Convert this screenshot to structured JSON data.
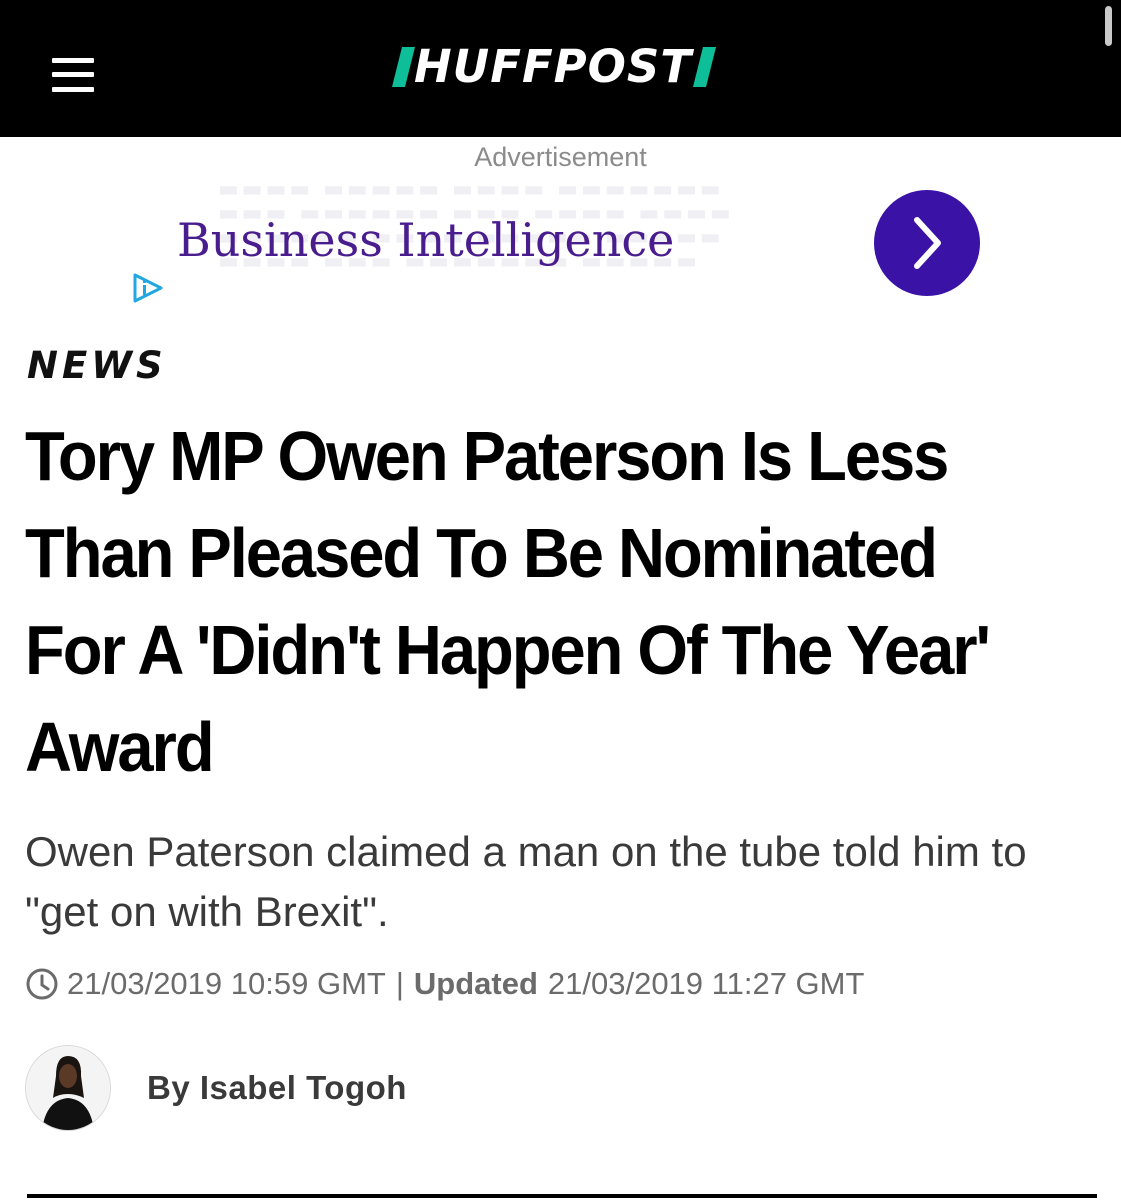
{
  "header": {
    "logo_text": "HUFFPOST",
    "menu_icon": "hamburger-menu-icon",
    "logo_accent_color": "#0dbe98",
    "background_color": "#000000"
  },
  "ad": {
    "label": "Advertisement",
    "headline": "Business Intelligence",
    "arrow_icon": "chevron-right-icon",
    "adchoices_icon": "adchoices-icon",
    "accent_color": "#3b12a6",
    "headline_color": "#4a1d8f"
  },
  "article": {
    "section": "NEWS",
    "headline": "Tory MP Owen Paterson Is Less Than Pleased To Be Nominated For A 'Didn't Happen Of The Year' Award",
    "dek": "Owen Paterson claimed a man on the tube told him to \"get on with Brexit\".",
    "published": "21/03/2019 10:59 GMT",
    "separator": "|",
    "updated_label": "Updated",
    "updated": "21/03/2019 11:27 GMT",
    "clock_icon": "clock-icon",
    "byline": "By Isabel Togoh"
  }
}
